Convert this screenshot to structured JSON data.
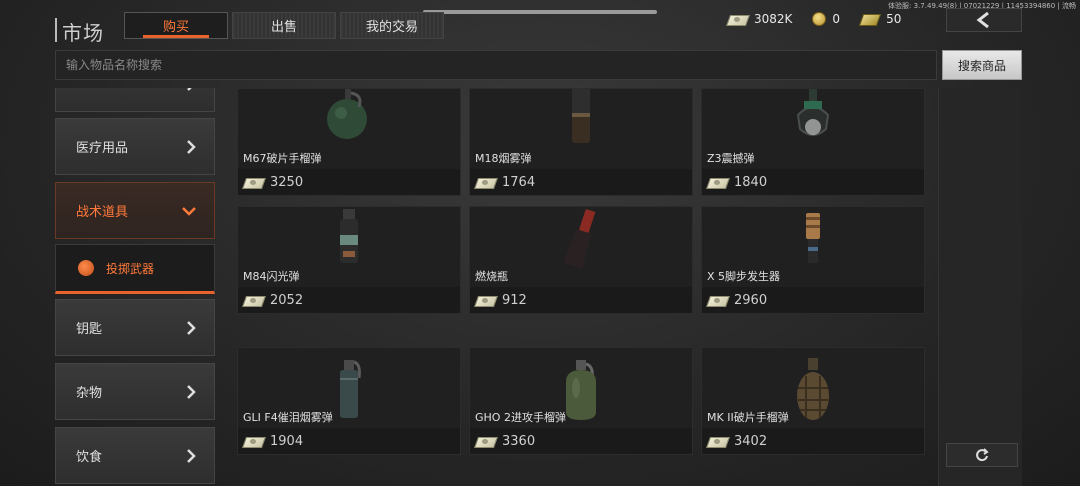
{
  "header": {
    "version": "体验服: 3.7.49.49(8) | 07021229 | 11453394860 | 流畅",
    "title": "市场",
    "tabs": [
      {
        "label": "购买",
        "active": true
      },
      {
        "label": "出售",
        "active": false
      },
      {
        "label": "我的交易",
        "active": false
      }
    ],
    "currency": {
      "cash": "3082K",
      "coins": "0",
      "gold_cash": "50"
    },
    "back_icon": "chevron-left-icon"
  },
  "search": {
    "placeholder": "输入物品名称搜索",
    "button_label": "搜索商品"
  },
  "sidebar": {
    "items": [
      {
        "label": "医疗用品",
        "icon": "chevron-right-icon"
      },
      {
        "label": "战术道具",
        "icon": "chevron-down-icon",
        "expanded": true
      },
      {
        "label": "投掷武器",
        "icon": "grenade-icon",
        "selected": true
      },
      {
        "label": "钥匙",
        "icon": "chevron-right-icon"
      },
      {
        "label": "杂物",
        "icon": "chevron-right-icon"
      },
      {
        "label": "饮食",
        "icon": "chevron-right-icon"
      }
    ]
  },
  "items": [
    {
      "name": "M67破片手榴弹",
      "price": "3250",
      "icon": "frag-grenade-icon"
    },
    {
      "name": "M18烟雾弹",
      "price": "1764",
      "icon": "smoke-grenade-icon"
    },
    {
      "name": "Z3震撼弹",
      "price": "1840",
      "icon": "concussion-grenade-icon"
    },
    {
      "name": "M84闪光弹",
      "price": "2052",
      "icon": "flashbang-icon"
    },
    {
      "name": "燃烧瓶",
      "price": "912",
      "icon": "molotov-icon"
    },
    {
      "name": "X 5脚步发生器",
      "price": "2960",
      "icon": "footstep-generator-icon"
    },
    {
      "name": "GLI F4催泪烟雾弹",
      "price": "1904",
      "icon": "tear-gas-icon"
    },
    {
      "name": "GHO 2进攻手榴弹",
      "price": "3360",
      "icon": "offensive-grenade-icon"
    },
    {
      "name": "MK II破片手榴弹",
      "price": "3402",
      "icon": "pineapple-grenade-icon"
    }
  ],
  "colors": {
    "accent": "#e8642c",
    "accent_text": "#ff7a3a"
  }
}
